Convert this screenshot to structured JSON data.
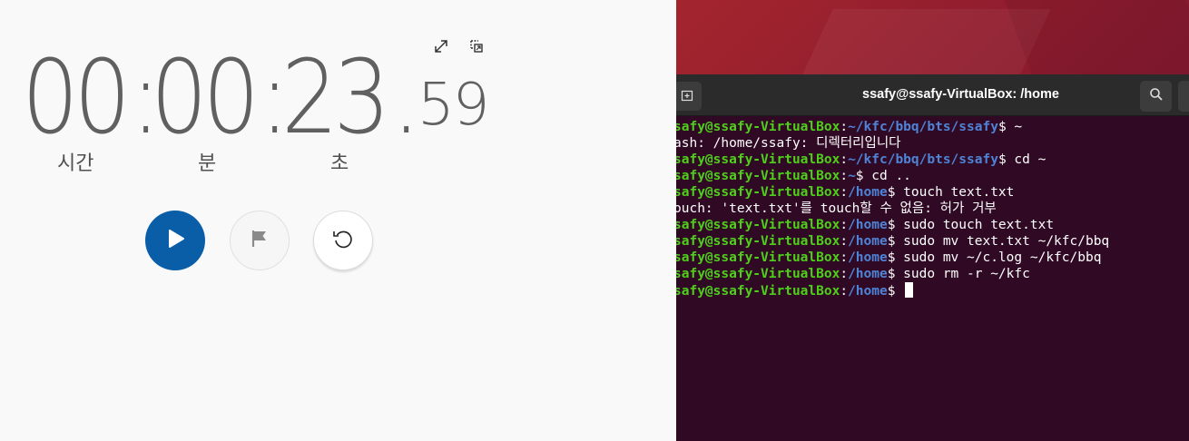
{
  "stopwatch": {
    "hours": "00",
    "minutes": "00",
    "seconds": "23",
    "hundredths": "59",
    "separator": ":",
    "decimal": ".",
    "labels": {
      "hours": "시간",
      "minutes": "분",
      "seconds": "초"
    },
    "icons": {
      "expand": "expand-icon",
      "pip": "picture-in-picture-icon",
      "play": "play-icon",
      "lap": "flag-icon",
      "reset": "reset-icon"
    },
    "colors": {
      "play_button": "#0a5ea8",
      "digits": "#606060"
    }
  },
  "terminal": {
    "title": "ssafy@ssafy-VirtualBox: /home",
    "icons": {
      "new_tab": "new-tab-icon",
      "search": "search-icon"
    },
    "colors": {
      "background": "#300a24",
      "user": "#4ed01a",
      "path": "#4f83d6"
    },
    "lines": [
      {
        "user": "safy@ssafy-VirtualBox",
        "sep": ":",
        "path": "~/kfc/bbq/bts/ssafy",
        "cmd": "$ ~"
      },
      {
        "text": "ash: /home/ssafy: 디렉터리입니다"
      },
      {
        "user": "safy@ssafy-VirtualBox",
        "sep": ":",
        "path": "~/kfc/bbq/bts/ssafy",
        "cmd": "$ cd ~"
      },
      {
        "user": "safy@ssafy-VirtualBox",
        "sep": ":",
        "path": "~",
        "cmd": "$ cd .."
      },
      {
        "user": "safy@ssafy-VirtualBox",
        "sep": ":",
        "path": "/home",
        "cmd": "$ touch text.txt"
      },
      {
        "text": "ouch: 'text.txt'를 touch할 수 없음: 허가 거부"
      },
      {
        "user": "safy@ssafy-VirtualBox",
        "sep": ":",
        "path": "/home",
        "cmd": "$ sudo touch text.txt"
      },
      {
        "user": "safy@ssafy-VirtualBox",
        "sep": ":",
        "path": "/home",
        "cmd": "$ sudo mv text.txt ~/kfc/bbq"
      },
      {
        "user": "safy@ssafy-VirtualBox",
        "sep": ":",
        "path": "/home",
        "cmd": "$ sudo mv ~/c.log ~/kfc/bbq"
      },
      {
        "user": "safy@ssafy-VirtualBox",
        "sep": ":",
        "path": "/home",
        "cmd": "$ sudo rm -r ~/kfc"
      },
      {
        "user": "safy@ssafy-VirtualBox",
        "sep": ":",
        "path": "/home",
        "cmd": "$ "
      }
    ]
  }
}
